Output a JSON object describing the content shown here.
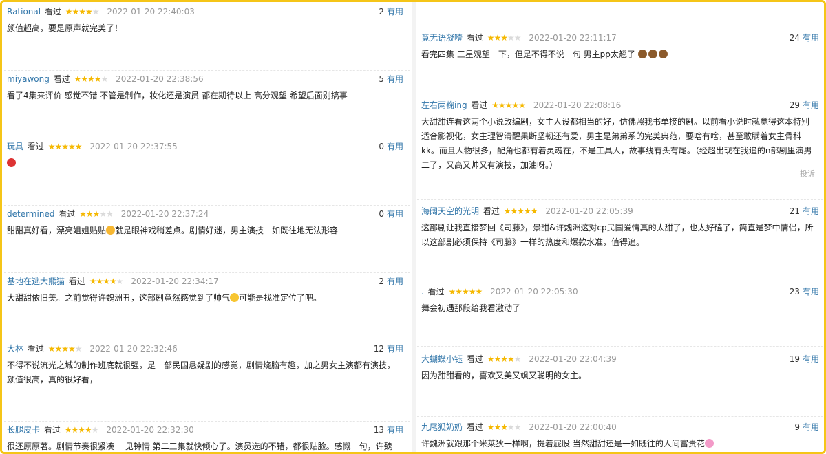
{
  "theme": {
    "border": "#f5c518",
    "link": "#3377aa",
    "star_on": "#f5b800",
    "star_off": "#dadada"
  },
  "left": [
    {
      "user": "Rational",
      "watched": "看过",
      "stars": 4,
      "time": "2022-01-20 22:40:03",
      "votes": "2",
      "useful": "有用",
      "text": "颜值超高，要是原声就完美了！"
    },
    {
      "user": "miyawong",
      "watched": "看过",
      "stars": 4,
      "time": "2022-01-20 22:38:56",
      "votes": "5",
      "useful": "有用",
      "text": "看了4集来评价 感觉不错 不管是制作，妆化还是演员 都在期待以上 高分观望 希望后面别搞事"
    },
    {
      "user": "玩具",
      "watched": "看过",
      "stars": 5,
      "time": "2022-01-20 22:37:55",
      "votes": "0",
      "useful": "有用",
      "text": "",
      "emoji": "angry-face-icon"
    },
    {
      "user": "determined",
      "watched": "看过",
      "stars": 3,
      "time": "2022-01-20 22:37:24",
      "votes": "0",
      "useful": "有用",
      "text_a": "甜甜真好看，漂亮姐姐贴贴",
      "text_b": "就是眼神戏稍差点。剧情好迷，男主演技一如既往地无法形容"
    },
    {
      "user": "基地在逃大熊猫",
      "watched": "看过",
      "stars": 4,
      "time": "2022-01-20 22:34:17",
      "votes": "2",
      "useful": "有用",
      "text_a": "大甜甜依旧美。之前觉得许魏洲丑，这部剧竟然感觉到了帅气",
      "text_b": "可能是找准定位了吧。"
    },
    {
      "user": "大林",
      "watched": "看过",
      "stars": 4,
      "time": "2022-01-20 22:32:46",
      "votes": "12",
      "useful": "有用",
      "text": "不得不说流光之城的制作班底就很强，是一部民国悬疑剧的感觉，剧情烧脑有趣，加之男女主演都有演技，颜值很高，真的很好看，"
    },
    {
      "user": "长腿皮卡",
      "watched": "看过",
      "stars": 4,
      "time": "2022-01-20 22:32:30",
      "votes": "13",
      "useful": "有用",
      "text": "很还原原著。剧情节奏很紧凑 一见钟情 第二三集就快倾心了。演员选的不错，都很贴脸。感慨一句，许魏"
    }
  ],
  "right": [
    {
      "user": "竟无语凝噎",
      "watched": "看过",
      "stars": 3,
      "time": "2022-01-20 22:11:17",
      "votes": "24",
      "useful": "有用",
      "text": "看完四集 三星观望一下，但是不得不说一句 男主pp太翘了"
    },
    {
      "user": "左右两鞠ing",
      "watched": "看过",
      "stars": 5,
      "time": "2022-01-20 22:08:16",
      "votes": "29",
      "useful": "有用",
      "text": "大甜甜连看这两个小说改编剧，女主人设都相当的好，仿佛照我书单接的剧。以前看小说时就觉得这本特别适合影视化，女主理智清醒果断坚韧还有爱，男主是弟弟系的完美典范，要啥有啥，甚至敢瞒着女主骨科kk。而且人物很多，配角也都有着灵魂在，不是工具人，故事线有头有尾。（经超出现在我追的n部剧里演男二了，又高又帅又有演技，加油呀。）",
      "report": "投诉"
    },
    {
      "user": "海阔天空的光明",
      "watched": "看过",
      "stars": 5,
      "time": "2022-01-20 22:05:39",
      "votes": "21",
      "useful": "有用",
      "text": "这部剧让我直接梦回《司藤》，景甜&许魏洲这对cp民国爱情真的太甜了，也太好磕了，简直是梦中情侣，所以这部剧必须保持《司藤》一样的热度和爆款水准，值得追。"
    },
    {
      "user": ".",
      "watched": "看过",
      "stars": 5,
      "time": "2022-01-20 22:05:30",
      "votes": "23",
      "useful": "有用",
      "text": "舞会初遇那段给我看激动了"
    },
    {
      "user": "大蝴蝶小钰",
      "watched": "看过",
      "stars": 4,
      "time": "2022-01-20 22:04:39",
      "votes": "19",
      "useful": "有用",
      "text": "因为甜甜看的，喜欢又美又飒又聪明的女主。"
    },
    {
      "user": "九尾狐奶奶",
      "watched": "看过",
      "stars": 3,
      "time": "2022-01-20 22:00:40",
      "votes": "9",
      "useful": "有用",
      "text": "许魏洲就跟那个米莱狄一样啊，提着屁股 当然甜甜还是一如既往的人间富贵花"
    }
  ]
}
